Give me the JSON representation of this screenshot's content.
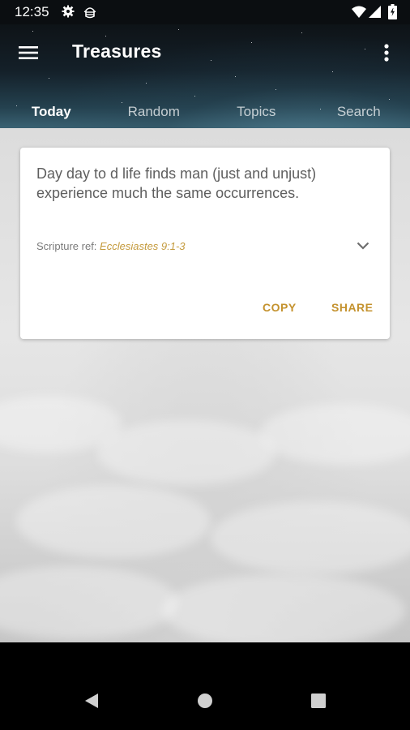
{
  "status_bar": {
    "time": "12:35",
    "icons": [
      "settings-icon",
      "android-debug-icon",
      "wifi-icon",
      "signal-icon",
      "battery-icon"
    ]
  },
  "app_bar": {
    "title": "Treasures",
    "menu_icon": "hamburger-menu-icon",
    "overflow_icon": "more-vert-icon"
  },
  "tabs": [
    {
      "label": "Today",
      "active": true
    },
    {
      "label": "Random",
      "active": false
    },
    {
      "label": "Topics",
      "active": false
    },
    {
      "label": "Search",
      "active": false
    }
  ],
  "card": {
    "quote": "Day day to d life finds man (just and unjust) experience much the same occurrences.",
    "ref_label": "Scripture ref:",
    "ref_value": "Ecclesiastes 9:1-3",
    "expand_icon": "chevron-down-icon",
    "actions": {
      "copy": "COPY",
      "share": "SHARE"
    }
  },
  "nav_bar": {
    "icons": [
      "back-icon",
      "home-icon",
      "recents-icon"
    ]
  },
  "colors": {
    "accent": "#c4922e",
    "ref_text": "#c49a3c",
    "app_bar_dark": "#0e1317",
    "app_bar_teal": "#3a6273"
  }
}
